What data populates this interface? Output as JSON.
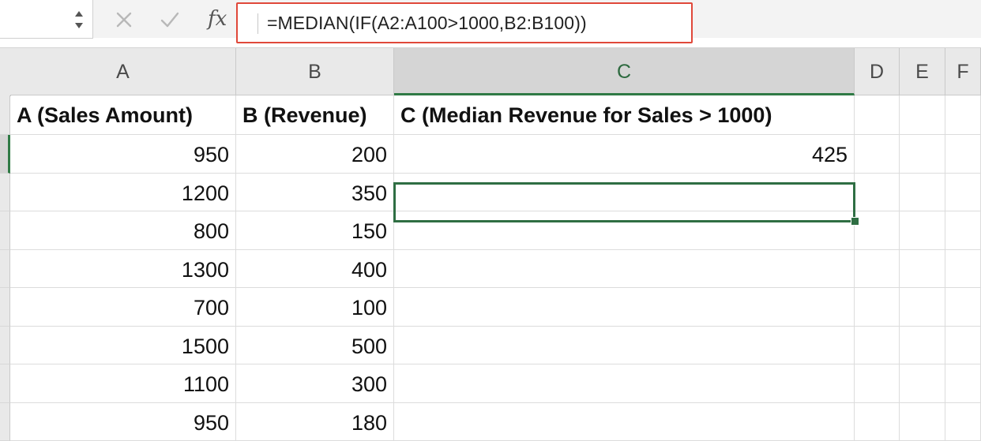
{
  "formula_bar": {
    "name_box": "",
    "fx_label": "fx",
    "formula": "=MEDIAN(IF(A2:A100>1000,B2:B100))"
  },
  "columns": [
    {
      "label": "A",
      "selected": false
    },
    {
      "label": "B",
      "selected": false
    },
    {
      "label": "C",
      "selected": true
    },
    {
      "label": "D",
      "selected": false
    },
    {
      "label": "E",
      "selected": false
    },
    {
      "label": "F",
      "selected": false
    }
  ],
  "header_row": {
    "a": "A (Sales Amount)",
    "b": "B (Revenue)",
    "c": "C (Median Revenue for Sales > 1000)"
  },
  "rows": [
    {
      "a": "950",
      "b": "200",
      "c": "425"
    },
    {
      "a": "1200",
      "b": "350",
      "c": ""
    },
    {
      "a": "800",
      "b": "150",
      "c": ""
    },
    {
      "a": "1300",
      "b": "400",
      "c": ""
    },
    {
      "a": "700",
      "b": "100",
      "c": ""
    },
    {
      "a": "1500",
      "b": "500",
      "c": ""
    },
    {
      "a": "1100",
      "b": "300",
      "c": ""
    },
    {
      "a": "950",
      "b": "180",
      "c": ""
    }
  ],
  "colors": {
    "selection": "#2f6e43",
    "formula_highlight": "#e0483a"
  }
}
